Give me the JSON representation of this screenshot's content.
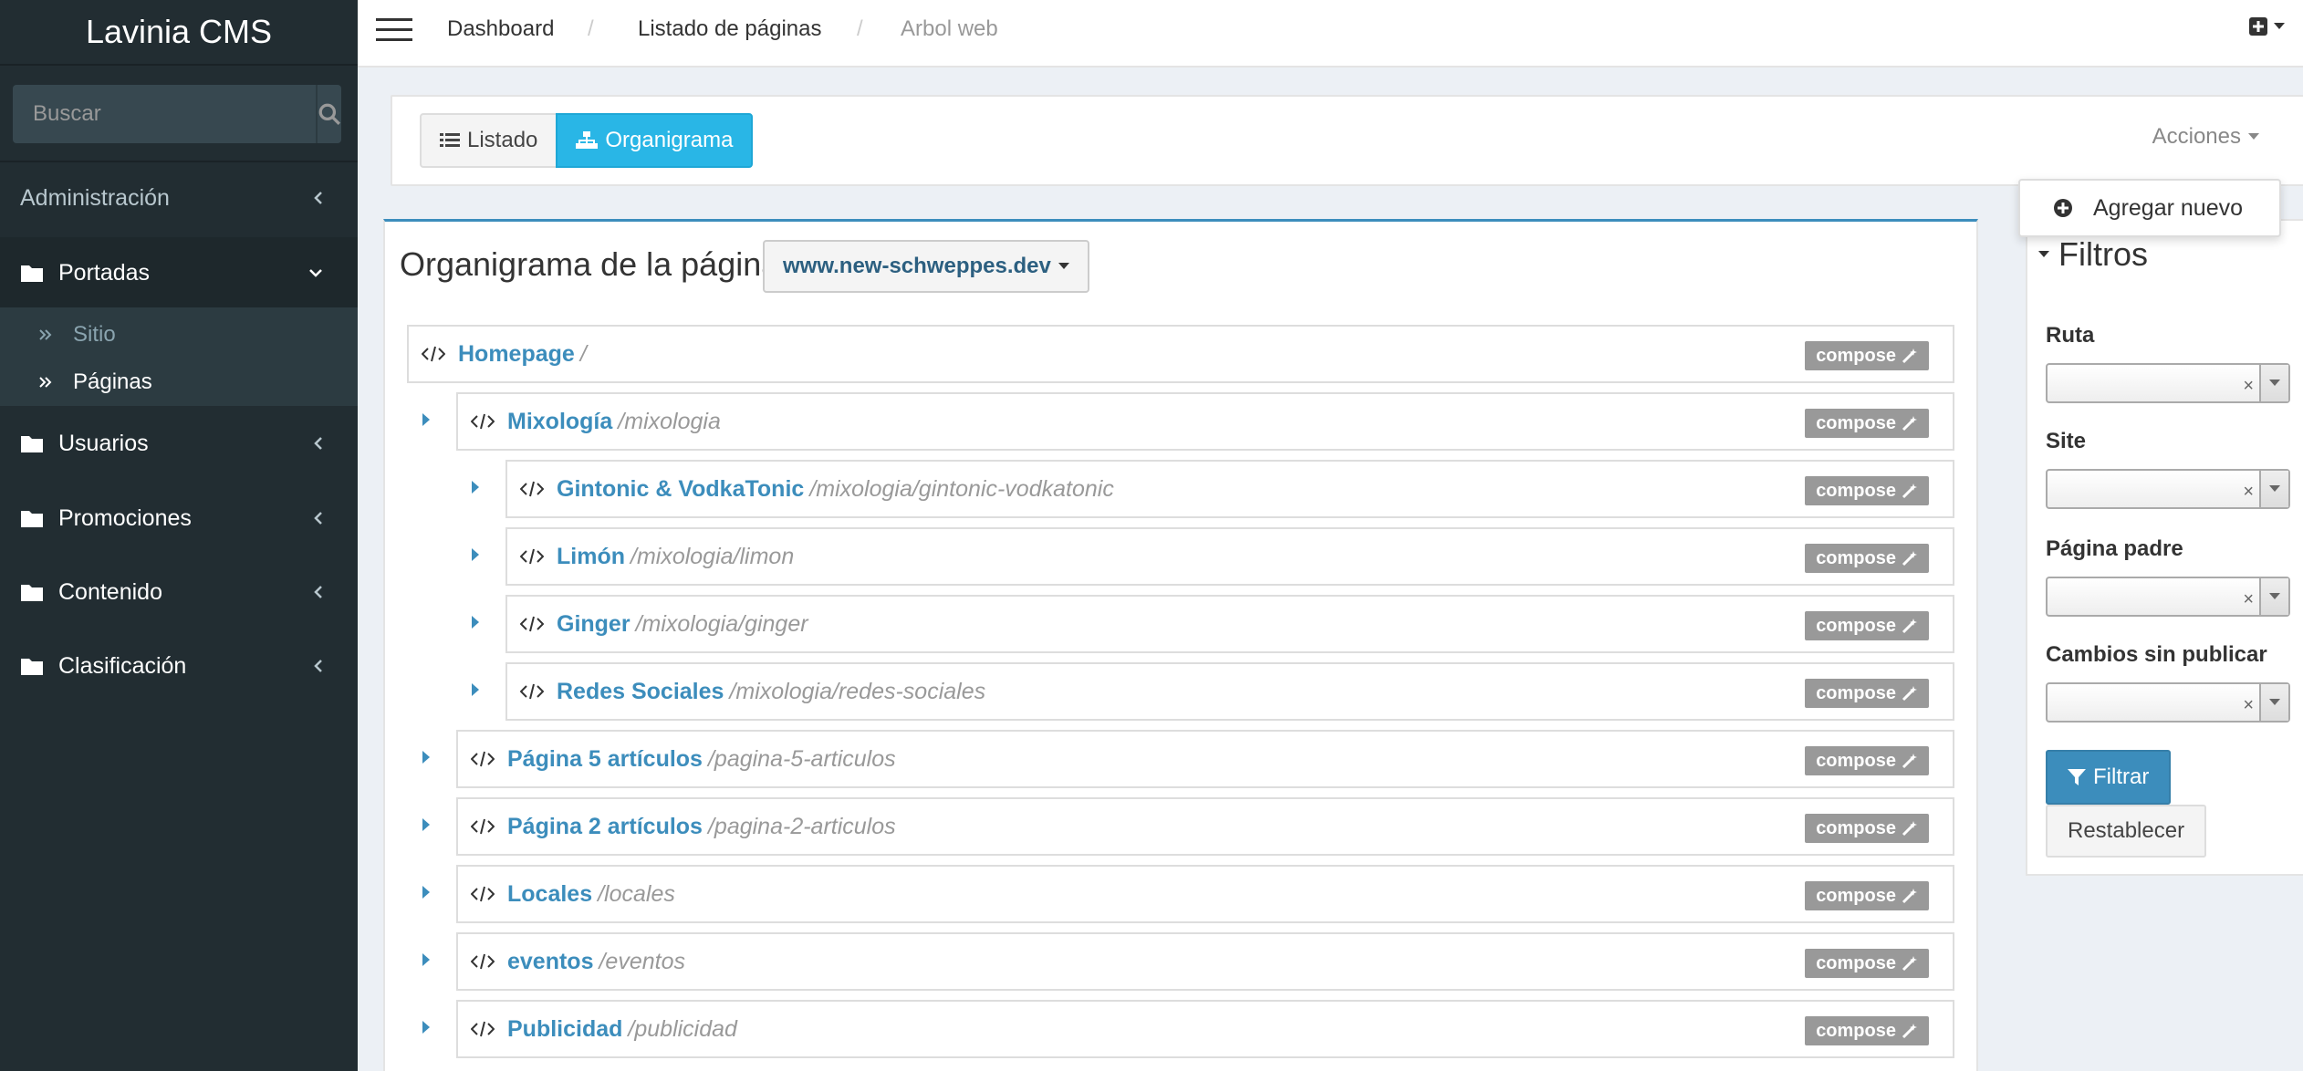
{
  "app": {
    "title": "Lavinia CMS"
  },
  "search": {
    "placeholder": "Buscar"
  },
  "sidebar": {
    "items": [
      {
        "label": "Administración"
      },
      {
        "label": "Portadas"
      },
      {
        "label": "Usuarios"
      },
      {
        "label": "Promociones"
      },
      {
        "label": "Contenido"
      },
      {
        "label": "Clasificación"
      }
    ],
    "portadas_sub": [
      {
        "label": "Sitio"
      },
      {
        "label": "Páginas"
      }
    ]
  },
  "breadcrumb": {
    "items": [
      {
        "label": "Dashboard"
      },
      {
        "label": "Listado de páginas"
      },
      {
        "label": "Arbol web"
      }
    ],
    "separator": "/"
  },
  "toolbar": {
    "listado_label": "Listado",
    "organigrama_label": "Organigrama",
    "acciones_label": "Acciones",
    "agregar_label": "Agregar nuevo"
  },
  "main": {
    "title": "Organigrama de la página",
    "site": "www.new-schweppes.dev",
    "compose_label": "compose",
    "rows": [
      {
        "name": "Homepage",
        "path": "/"
      },
      {
        "name": "Mixología",
        "path": "/mixologia"
      },
      {
        "name": "Gintonic & VodkaTonic",
        "path": "/mixologia/gintonic-vodkatonic"
      },
      {
        "name": "Limón",
        "path": "/mixologia/limon"
      },
      {
        "name": "Ginger",
        "path": "/mixologia/ginger"
      },
      {
        "name": "Redes Sociales",
        "path": "/mixologia/redes-sociales"
      },
      {
        "name": "Página 5 artículos",
        "path": "/pagina-5-articulos"
      },
      {
        "name": "Página 2 artículos",
        "path": "/pagina-2-articulos"
      },
      {
        "name": "Locales",
        "path": "/locales"
      },
      {
        "name": "eventos",
        "path": "/eventos"
      },
      {
        "name": "Publicidad",
        "path": "/publicidad"
      }
    ]
  },
  "filters": {
    "title": "Filtros",
    "fields": [
      {
        "label": "Ruta",
        "value": ""
      },
      {
        "label": "Site",
        "value": ""
      },
      {
        "label": "Página padre",
        "value": ""
      },
      {
        "label": "Cambios sin publicar",
        "value": ""
      }
    ],
    "clear_glyph": "×",
    "filter_label": "Filtrar",
    "reset_label": "Restablecer"
  },
  "colors": {
    "sidebar_bg": "#222d32",
    "accent": "#3c8dbc",
    "organigrama_active": "#29b6e6",
    "compose_bg": "#999999"
  }
}
